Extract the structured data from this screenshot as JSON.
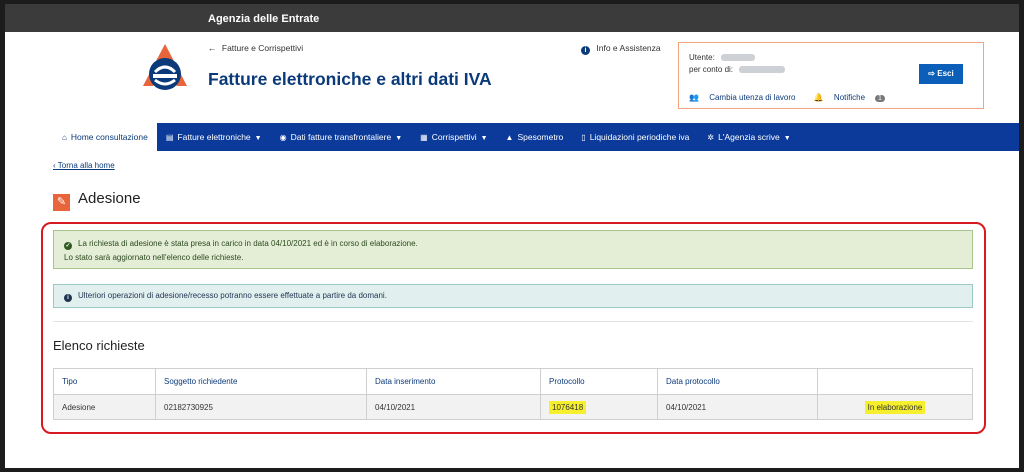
{
  "topbar": {
    "agency": "Agenzia delle Entrate"
  },
  "header": {
    "back_label": "Fatture e Corrispettivi",
    "title": "Fatture elettroniche e altri dati IVA",
    "info_label": "Info e Assistenza"
  },
  "user": {
    "user_label": "Utente:",
    "on_behalf_label": "per conto di:",
    "change_workspace": "Cambia utenza di lavoro",
    "notifications": "Notifiche",
    "notifications_count": "1",
    "logout": "Esci"
  },
  "nav": {
    "items": [
      {
        "label": "Home consultazione",
        "icon": "home-icon"
      },
      {
        "label": "Fatture elettroniche",
        "icon": "file-icon"
      },
      {
        "label": "Dati fatture transfrontaliere",
        "icon": "globe-icon"
      },
      {
        "label": "Corrispettivi",
        "icon": "register-icon"
      },
      {
        "label": "Spesometro",
        "icon": "shop-icon"
      },
      {
        "label": "Liquidazioni periodiche iva",
        "icon": "document-icon"
      },
      {
        "label": "L'Agenzia scrive",
        "icon": "settings-icon"
      }
    ]
  },
  "breadcrumb": {
    "label": "Torna alla home"
  },
  "page": {
    "title": "Adesione"
  },
  "alerts": {
    "success_line1": "La richiesta di adesione è stata presa in carico in data 04/10/2021 ed è in corso di elaborazione.",
    "success_line2": "Lo stato sarà aggiornato nell'elenco delle richieste.",
    "info": "Ulteriori operazioni di adesione/recesso potranno essere effettuate a partire da domani."
  },
  "requests": {
    "title": "Elenco richieste",
    "headers": [
      "Tipo",
      "Soggetto richiedente",
      "Data inserimento",
      "Protocollo",
      "Data protocollo",
      ""
    ],
    "rows": [
      [
        "Adesione",
        "02182730925",
        "04/10/2021",
        "1076418",
        "04/10/2021",
        "In elaborazione"
      ]
    ]
  },
  "colors": {
    "brand_blue": "#0b3a9a",
    "accent_orange": "#e8643a",
    "annotation_red": "#d8191f",
    "highlight_yellow": "#f6ef2e"
  }
}
